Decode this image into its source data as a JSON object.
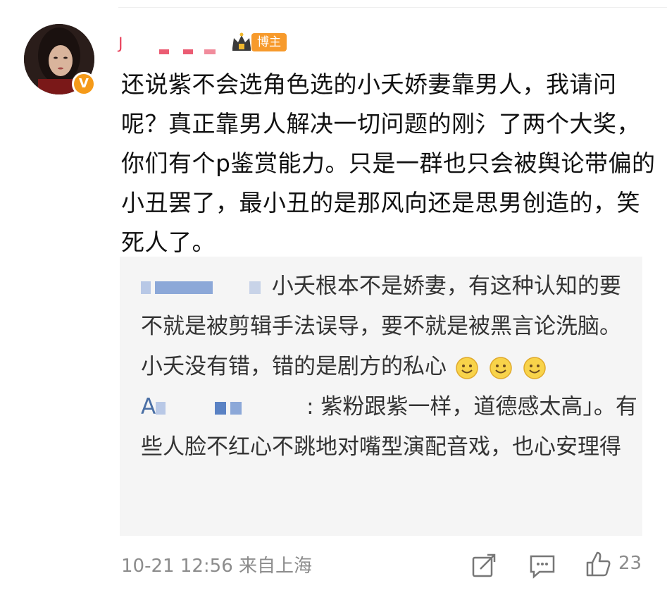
{
  "author": {
    "name_visible_char": "J",
    "badge_label": "博主",
    "verified_mark": "V",
    "brand_color": "#e8405a"
  },
  "post": {
    "text": "还说紫不会选角色选的小夭娇妻靠男人，我请问呢？真正靠男人解决一切问题的刚氵了两个大奖，你们有个p鉴赏能力。只是一群也只会被舆论带偏的小丑罢了，最小丑的是那风向还是思男创造的，笑死人了。"
  },
  "quote": {
    "reply1_text": "小夭根本不是娇妻，有这种认知的要不就是被剪辑手法误导，要不就是被黑言论洗脑。小夭没有错，错的是剧方的私心",
    "reply2_name_start": "A",
    "reply2_name_end": "",
    "reply2_text": ": 紫粉跟紫一样，道德感太高」。有些人脸不红心不跳地对嘴型演配音戏，也心安理得",
    "emoji": "smile-emoji"
  },
  "footer": {
    "timestamp": "10-21 12:56",
    "location": "来自上海",
    "likes": "23"
  },
  "icons": [
    "crown-icon",
    "share-icon",
    "comment-icon",
    "like-icon",
    "smile-emoji"
  ]
}
